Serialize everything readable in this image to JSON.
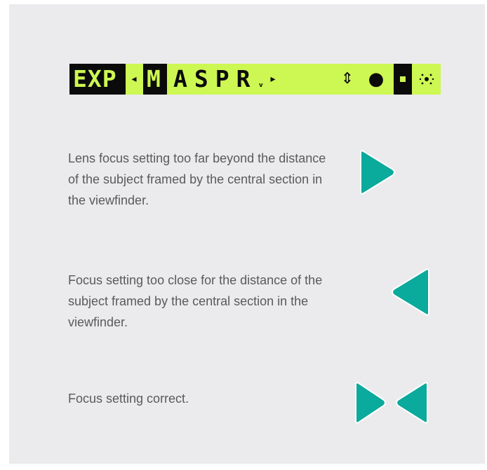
{
  "colors": {
    "panel_bg": "#ebebed",
    "lcd_bg": "#cdf752",
    "lcd_dark": "#0b0b0b",
    "arrow_fill": "#0aaa9c",
    "text": "#5a5a5a"
  },
  "lcd": {
    "exp_label": "EXP",
    "mode_selected": "M",
    "modes_rest": "ASPR",
    "small_mark": "ᵥ",
    "left_pointer_icon": "triangle-left-small",
    "right_pointer_icon": "triangle-right-small",
    "updown_icon": "up-down-arrows",
    "metering_icons": [
      "dot",
      "dot-in-square",
      "multi-dot"
    ]
  },
  "rows": [
    {
      "description": "Lens focus setting too far beyond the distance of the subject framed by the central section in the viewfinder.",
      "indicator": "arrow-right"
    },
    {
      "description": "Focus setting too close for the distance of the subject framed by the central section in the viewfinder.",
      "indicator": "arrow-left"
    },
    {
      "description": "Focus setting correct.",
      "indicator": "arrows-converging"
    }
  ]
}
